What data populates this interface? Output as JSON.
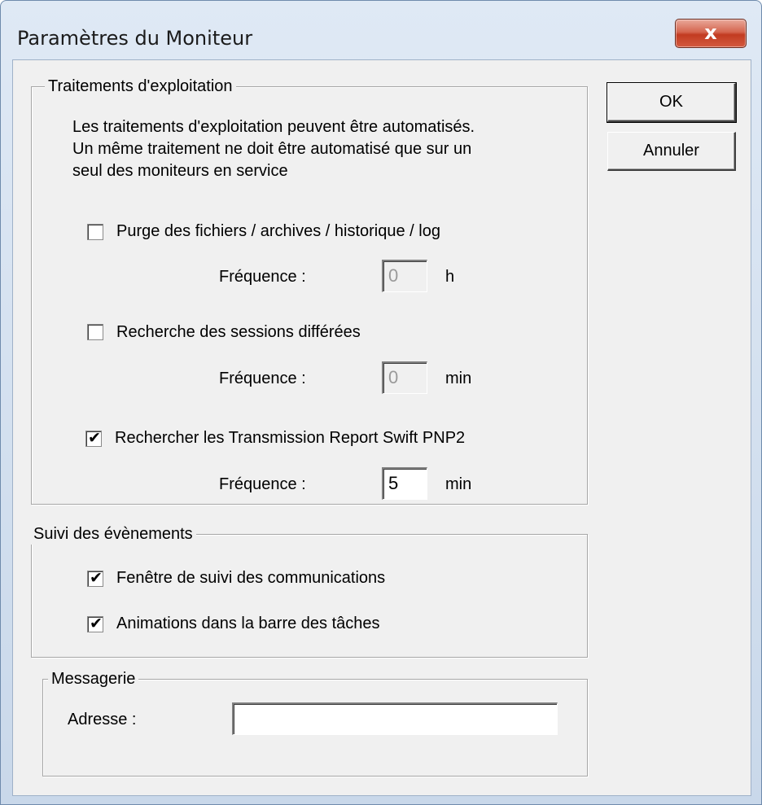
{
  "window": {
    "title": "Paramètres du Moniteur",
    "close_glyph": "x"
  },
  "buttons": {
    "ok": "OK",
    "cancel": "Annuler"
  },
  "traitements": {
    "legend": "Traitements d'exploitation",
    "description": "Les traitements d'exploitation peuvent être automatisés.\nUn même traitement ne doit être automatisé que sur un\nseul des moniteurs en service",
    "items": [
      {
        "label": "Purge des fichiers / archives / historique / log",
        "checked": false,
        "check_glyph": "",
        "freq_label": "Fréquence :",
        "value": "0",
        "unit": "h",
        "enabled": false
      },
      {
        "label": "Recherche des sessions différées",
        "checked": false,
        "check_glyph": "",
        "freq_label": "Fréquence :",
        "value": "0",
        "unit": "min",
        "enabled": false
      },
      {
        "label": "Rechercher les Transmission Report Swift PNP2",
        "checked": true,
        "check_glyph": "✔",
        "freq_label": "Fréquence :",
        "value": "5",
        "unit": "min",
        "enabled": true
      }
    ]
  },
  "suivi": {
    "legend": "Suivi des évènements",
    "items": [
      {
        "label": "Fenêtre de suivi des communications",
        "checked": true,
        "check_glyph": "✔"
      },
      {
        "label": "Animations dans la barre des tâches",
        "checked": true,
        "check_glyph": "✔"
      }
    ]
  },
  "messagerie": {
    "legend": "Messagerie",
    "address_label": "Adresse :",
    "address_value": ""
  },
  "colors": {
    "dialog_bg": "#f0f0f0",
    "title_bg": "#dfe9f5",
    "close_btn": "#c23b21"
  }
}
